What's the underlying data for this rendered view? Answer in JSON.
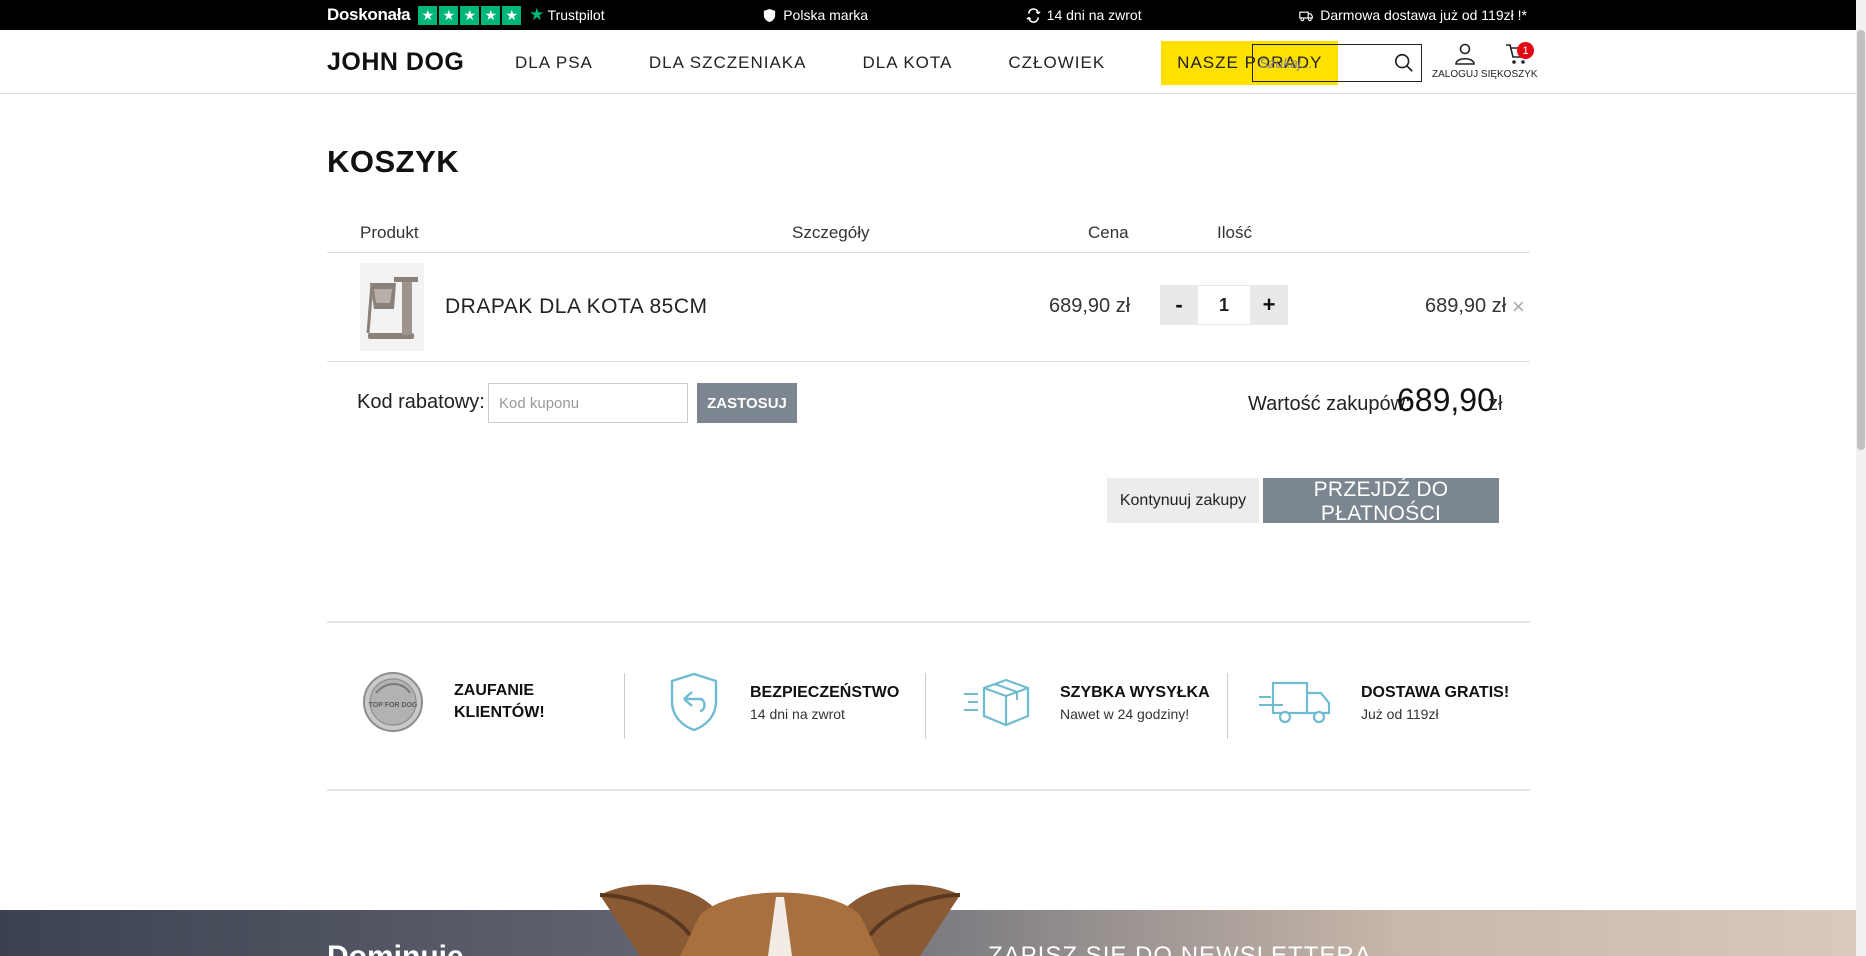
{
  "topbar": {
    "rating_label": "Doskonała",
    "stars": [
      "★",
      "★",
      "★",
      "★",
      "★"
    ],
    "trustpilot": "Trustpilot",
    "brand_item": "Polska marka",
    "return_item": "14 dni na zwrot",
    "delivery_item": "Darmowa dostawa już od 119zł !*"
  },
  "header": {
    "logo": "JOHN DOG",
    "nav": [
      "DLA PSA",
      "DLA SZCZENIAKA",
      "DLA KOTA",
      "CZŁOWIEK",
      "NASZE PORADY"
    ],
    "search_placeholder": "Szukaj...",
    "login_label": "ZALOGUJ SIĘ",
    "cart_label": "KOSZYK",
    "cart_count": "1"
  },
  "cart": {
    "title": "KOSZYK",
    "columns": {
      "product": "Produkt",
      "details": "Szczegóły",
      "price": "Cena",
      "quantity": "Ilość"
    },
    "items": [
      {
        "name": "DRAPAK DLA KOTA 85CM",
        "price": "689,90 zł",
        "quantity": "1",
        "total": "689,90 zł",
        "minus": "-",
        "plus": "+",
        "remove": "×"
      }
    ],
    "coupon_label": "Kod rabatowy:",
    "coupon_placeholder": "Kod kuponu",
    "apply_label": "ZASTOSUJ",
    "total_label": "Wartość zakupów:",
    "total_value": "689,90",
    "total_currency": "zł",
    "continue_label": "Kontynuuj zakupy",
    "checkout_label": "PRZEJDŹ DO PŁATNOŚCI"
  },
  "features": [
    {
      "title_line1": "ZAUFANIE",
      "title_line2": "KLIENTÓW!",
      "subtitle": ""
    },
    {
      "title_line1": "BEZPIECZEŃSTWO",
      "title_line2": "",
      "subtitle": "14 dni na zwrot"
    },
    {
      "title_line1": "SZYBKA WYSYŁKA",
      "title_line2": "",
      "subtitle": "Nawet w 24 godziny!"
    },
    {
      "title_line1": "DOSTAWA GRATIS!",
      "title_line2": "",
      "subtitle": "Już od 119zł"
    }
  ],
  "badge_text": "TOP FOR DOG",
  "footer": {
    "left_heading": "Dominuje",
    "right_heading": "ZAPISZ SIĘ DO NEWSLETTERA"
  },
  "colors": {
    "accent_yellow": "#ffe100",
    "button_gray": "#7c8690",
    "trustpilot_green": "#00b67a",
    "badge_red": "#e30613",
    "icon_blue": "#6fbcd1"
  }
}
